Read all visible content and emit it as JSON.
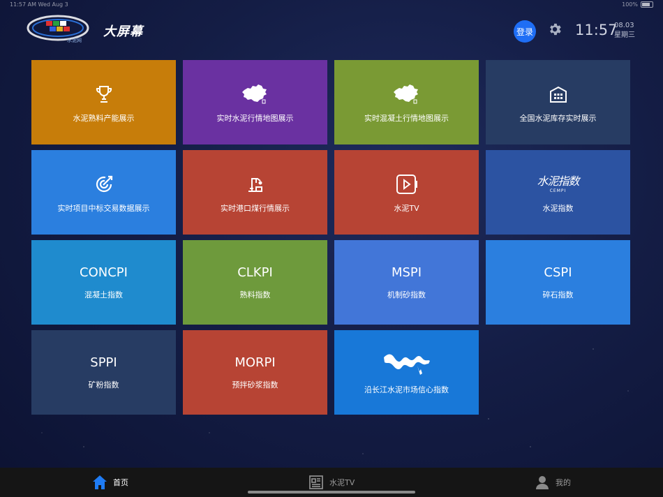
{
  "status_bar": {
    "left": "11:57 AM   Wed Aug 3",
    "right": "100%"
  },
  "header": {
    "logo_text": "水泥网",
    "brand": "大屏幕",
    "login_label": "登录",
    "time": "11:57",
    "date": "08.03",
    "weekday": "星期三"
  },
  "tiles": [
    {
      "label": "水泥熟料产能展示",
      "icon": "trophy-icon",
      "color": "#c77d0a"
    },
    {
      "label": "实时水泥行情地图展示",
      "icon": "china-map-icon",
      "color": "#6a31a1"
    },
    {
      "label": "实时混凝土行情地图展示",
      "icon": "china-map-icon",
      "color": "#7a9a34"
    },
    {
      "label": "全国水泥库存实时展示",
      "icon": "warehouse-icon",
      "color": "#273c63"
    },
    {
      "label": "实时项目中标交易数据展示",
      "icon": "target-icon",
      "color": "#2b7fdf"
    },
    {
      "label": "实时港口煤行情展示",
      "icon": "crane-icon",
      "color": "#b74434"
    },
    {
      "label": "水泥TV",
      "icon": "video-play-icon",
      "color": "#b74434"
    },
    {
      "label": "水泥指数",
      "icon": "cement-index-logo",
      "logo_text": "水泥指数",
      "logo_sub": "CEMPI",
      "color": "#2c53a2"
    },
    {
      "label": "混凝土指数",
      "big": "CONCPI",
      "color": "#1f8bce"
    },
    {
      "label": "熟料指数",
      "big": "CLKPI",
      "color": "#6e9a3c"
    },
    {
      "label": "机制砂指数",
      "big": "MSPI",
      "color": "#4276d8"
    },
    {
      "label": "碎石指数",
      "big": "CSPI",
      "color": "#2b7fdf"
    },
    {
      "label": "矿粉指数",
      "big": "SPPI",
      "color": "#273c63"
    },
    {
      "label": "预拌砂浆指数",
      "big": "MORPI",
      "color": "#b74434"
    },
    {
      "label": "沿长江水泥市场信心指数",
      "icon": "yangtze-river-icon",
      "color": "#1878d8"
    }
  ],
  "tabbar": [
    {
      "label": "首页",
      "icon": "home-icon",
      "active": true
    },
    {
      "label": "水泥TV",
      "icon": "news-icon",
      "active": false
    },
    {
      "label": "我的",
      "icon": "user-icon",
      "active": false
    }
  ]
}
